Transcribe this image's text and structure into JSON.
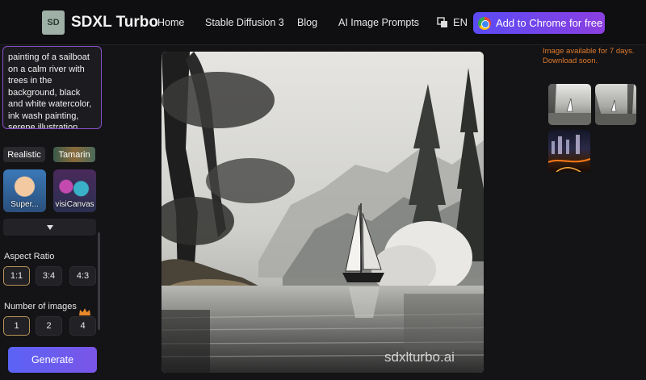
{
  "header": {
    "logo_text": "SD",
    "brand": "SDXL Turbo",
    "nav": [
      "Home",
      "Stable Diffusion 3",
      "Blog",
      "AI Image Prompts"
    ],
    "language": "EN",
    "cta": "Add to Chrome for free"
  },
  "sidebar": {
    "prompt": "painting of a sailboat on a calm river with trees in the background, black and white watercolor, ink wash painting, serene illustration",
    "styles": {
      "chip_realistic": "Realistic",
      "chip_tamarin": "Tamarin",
      "card_super": "Super...",
      "card_visi": "visiCanvas"
    },
    "aspect_ratio": {
      "label": "Aspect Ratio",
      "options": [
        "1:1",
        "3:4",
        "4:3"
      ],
      "selected": "1:1"
    },
    "number_of_images": {
      "label": "Number of images",
      "options": [
        "1",
        "2",
        "4"
      ],
      "selected": "1"
    },
    "generate": "Generate"
  },
  "main": {
    "watermark": "sdxlturbo.ai"
  },
  "history": {
    "notice": "Image available for 7 days. Download soon."
  },
  "colors": {
    "accent_purple": "#8a4fc8",
    "cta_gradient_start": "#5b4bf5",
    "notice_orange": "#e07a2a",
    "selected_border": "#b89456"
  }
}
